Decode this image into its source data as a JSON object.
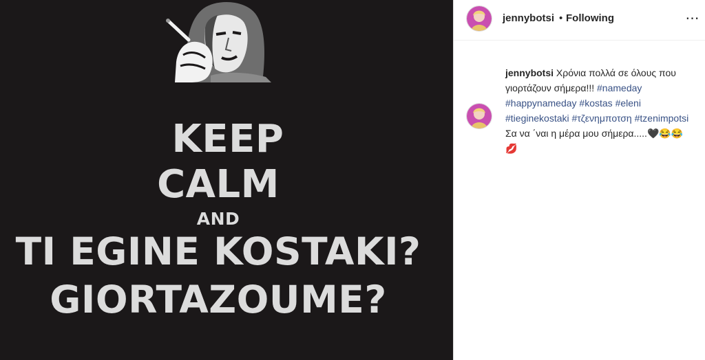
{
  "poster": {
    "line1": "KEEP",
    "line2": "CALM",
    "line3": "AND",
    "line4": "TI EGINE KOSTAKI?",
    "line5": "GIORTAZOUME?"
  },
  "header": {
    "username": "jennybotsi",
    "separator": "•",
    "follow_status": "Following",
    "more_icon": "⋯"
  },
  "caption": {
    "username": "jennybotsi",
    "text1": "Χρόνια πολλά σε όλους που γιορτάζουν σήμερα!!!",
    "tags1": [
      "#nameday",
      "#happynameday",
      "#kostas",
      "#eleni",
      "#tieginekostaki",
      "#τζενημποτση",
      "#tzenimpotsi"
    ],
    "text2": "Σα να ΄ναι η μέρα μου σήμερα.....",
    "emojis": "🖤😂😂💋"
  },
  "colors": {
    "poster_bg": "#1b1819",
    "poster_text": "#dcdcdc",
    "link": "#385185"
  }
}
